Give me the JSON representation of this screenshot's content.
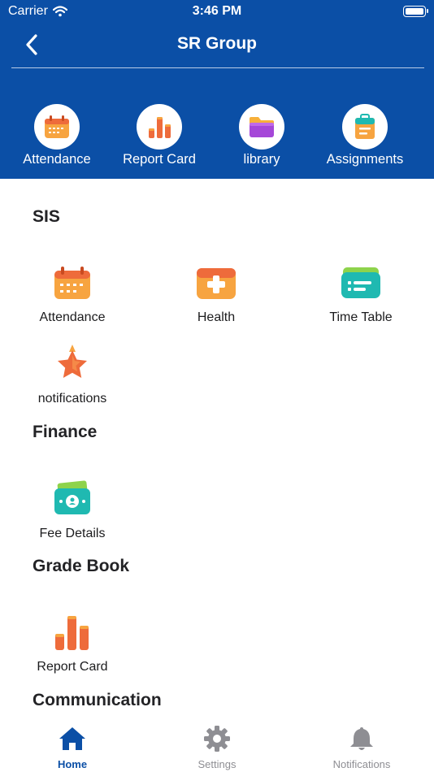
{
  "status_bar": {
    "carrier": "Carrier",
    "time": "3:46 PM"
  },
  "nav": {
    "title": "SR Group"
  },
  "quick_actions": [
    {
      "label": "Attendance",
      "icon": "calendar-icon"
    },
    {
      "label": "Report Card",
      "icon": "bar-chart-icon"
    },
    {
      "label": "library",
      "icon": "folder-icon"
    },
    {
      "label": "Assignments",
      "icon": "clipboard-icon"
    }
  ],
  "sections": {
    "sis": {
      "title": "SIS",
      "items": [
        {
          "label": "Attendance",
          "icon": "calendar-icon"
        },
        {
          "label": "Health",
          "icon": "medical-kit-icon"
        },
        {
          "label": "Time Table",
          "icon": "card-icon"
        },
        {
          "label": "notifications",
          "icon": "star-icon"
        }
      ]
    },
    "finance": {
      "title": "Finance",
      "items": [
        {
          "label": "Fee Details",
          "icon": "money-icon"
        }
      ]
    },
    "grade_book": {
      "title": "Grade Book",
      "items": [
        {
          "label": "Report Card",
          "icon": "bar-chart-icon"
        }
      ]
    },
    "communication": {
      "title": "Communication"
    }
  },
  "tabbar": {
    "active": "Home",
    "tabs": [
      {
        "label": "Home",
        "icon": "home-icon"
      },
      {
        "label": "Settings",
        "icon": "gear-icon"
      },
      {
        "label": "Notifications",
        "icon": "bell-icon"
      }
    ]
  },
  "colors": {
    "header_bg": "#0b4fa6",
    "accent": "#0b4fa6",
    "inactive": "#8e8e93"
  }
}
